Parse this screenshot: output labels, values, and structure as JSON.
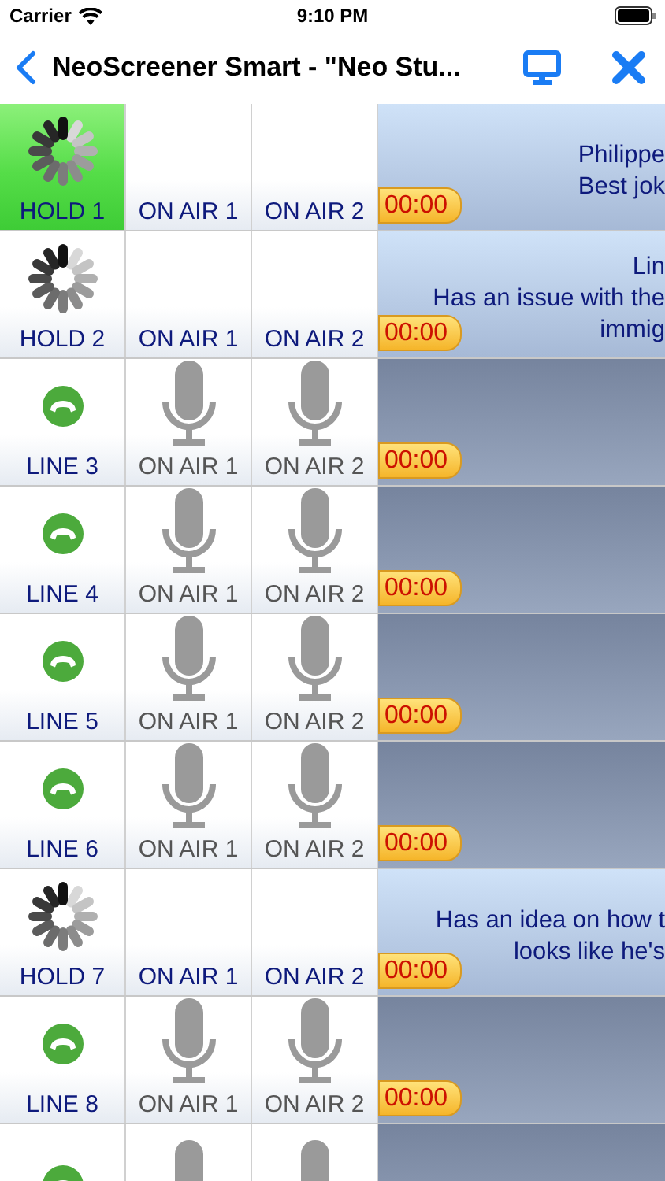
{
  "status_bar": {
    "carrier": "Carrier",
    "time": "9:10 PM"
  },
  "nav": {
    "title": "NeoScreener Smart - \"Neo Stu..."
  },
  "rows": [
    {
      "kind": "hold",
      "label": "HOLD 1",
      "selected": true,
      "on_air": [
        "ON AIR 1",
        "ON AIR 2"
      ],
      "timer": "00:00",
      "caller_lines": [
        "Philippe",
        "Best jok"
      ]
    },
    {
      "kind": "hold",
      "label": "HOLD 2",
      "selected": false,
      "on_air": [
        "ON AIR 1",
        "ON AIR 2"
      ],
      "timer": "00:00",
      "caller_lines": [
        "Lin",
        "Has an issue with the",
        "immig"
      ]
    },
    {
      "kind": "line",
      "label": "LINE 3",
      "selected": false,
      "on_air": [
        "ON AIR 1",
        "ON AIR 2"
      ],
      "timer": "00:00"
    },
    {
      "kind": "line",
      "label": "LINE 4",
      "selected": false,
      "on_air": [
        "ON AIR 1",
        "ON AIR 2"
      ],
      "timer": "00:00"
    },
    {
      "kind": "line",
      "label": "LINE 5",
      "selected": false,
      "on_air": [
        "ON AIR 1",
        "ON AIR 2"
      ],
      "timer": "00:00"
    },
    {
      "kind": "line",
      "label": "LINE 6",
      "selected": false,
      "on_air": [
        "ON AIR 1",
        "ON AIR 2"
      ],
      "timer": "00:00"
    },
    {
      "kind": "hold",
      "label": "HOLD 7",
      "selected": false,
      "on_air": [
        "ON AIR 1",
        "ON AIR 2"
      ],
      "timer": "00:00",
      "caller_lines": [
        "Has an idea on how t",
        "looks like he's"
      ]
    },
    {
      "kind": "line",
      "label": "LINE 8",
      "selected": false,
      "on_air": [
        "ON AIR 1",
        "ON AIR 2"
      ],
      "timer": "00:00"
    },
    {
      "kind": "line",
      "selected": false
    }
  ]
}
